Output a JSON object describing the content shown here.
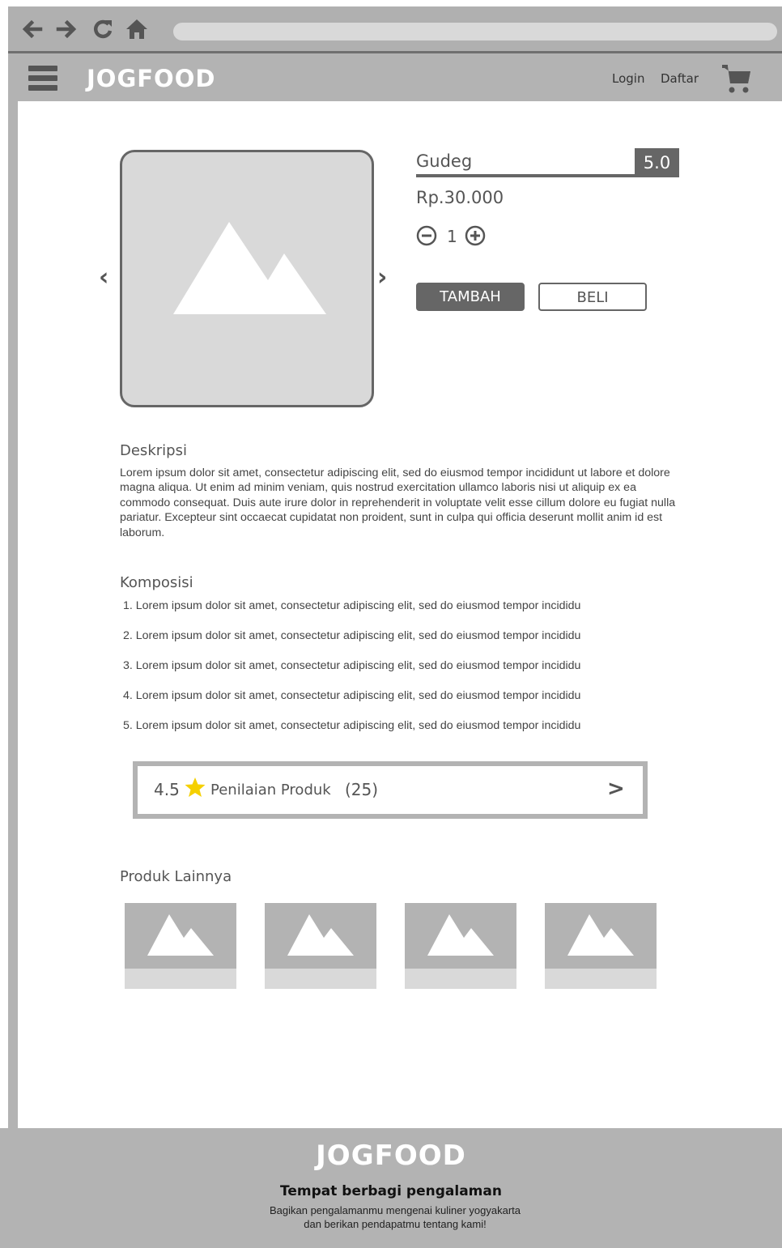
{
  "header": {
    "logo": "JOGFOOD",
    "login": "Login",
    "daftar": "Daftar"
  },
  "product": {
    "name": "Gudeg",
    "rating": "5.0",
    "price": "Rp.30.000",
    "quantity": "1",
    "add_label": "TAMBAH",
    "buy_label": "BELI"
  },
  "description": {
    "title": "Deskripsi",
    "text": "Lorem ipsum dolor sit amet, consectetur adipiscing elit, sed do eiusmod tempor incididunt ut labore et dolore magna aliqua. Ut enim ad minim veniam, quis nostrud exercitation ullamco laboris nisi ut aliquip ex ea commodo consequat. Duis aute irure dolor in reprehenderit in voluptate velit esse cillum dolore eu fugiat nulla pariatur. Excepteur sint occaecat cupidatat non proident, sunt in culpa qui officia deserunt mollit anim id est laborum."
  },
  "composition": {
    "title": "Komposisi",
    "items": [
      "1. Lorem ipsum dolor sit amet, consectetur adipiscing elit, sed do eiusmod tempor incididu",
      "2. Lorem ipsum dolor sit amet, consectetur adipiscing elit, sed do eiusmod tempor incididu",
      "3. Lorem ipsum dolor sit amet, consectetur adipiscing elit, sed do eiusmod tempor incididu",
      "4. Lorem ipsum dolor sit amet, consectetur adipiscing elit, sed do eiusmod tempor incididu",
      "5. Lorem ipsum dolor sit amet, consectetur adipiscing elit, sed do eiusmod tempor incididu"
    ]
  },
  "review": {
    "score": "4.5",
    "label": "Penilaian Produk",
    "count": "(25)",
    "arrow": ">"
  },
  "other_products": {
    "title": "Produk Lainnya"
  },
  "footer": {
    "logo": "JOGFOOD",
    "tagline": "Tempat berbagi pengalaman",
    "text": "Bagikan pengalamanmu mengenai kuliner yogyakarta dan berikan pendapatmu tentang kami!"
  },
  "colors": {
    "bar_gray": "#b3b3b3",
    "dark_gray": "#666666",
    "placeholder": "#d9d9d9",
    "star": "#f5d000"
  }
}
